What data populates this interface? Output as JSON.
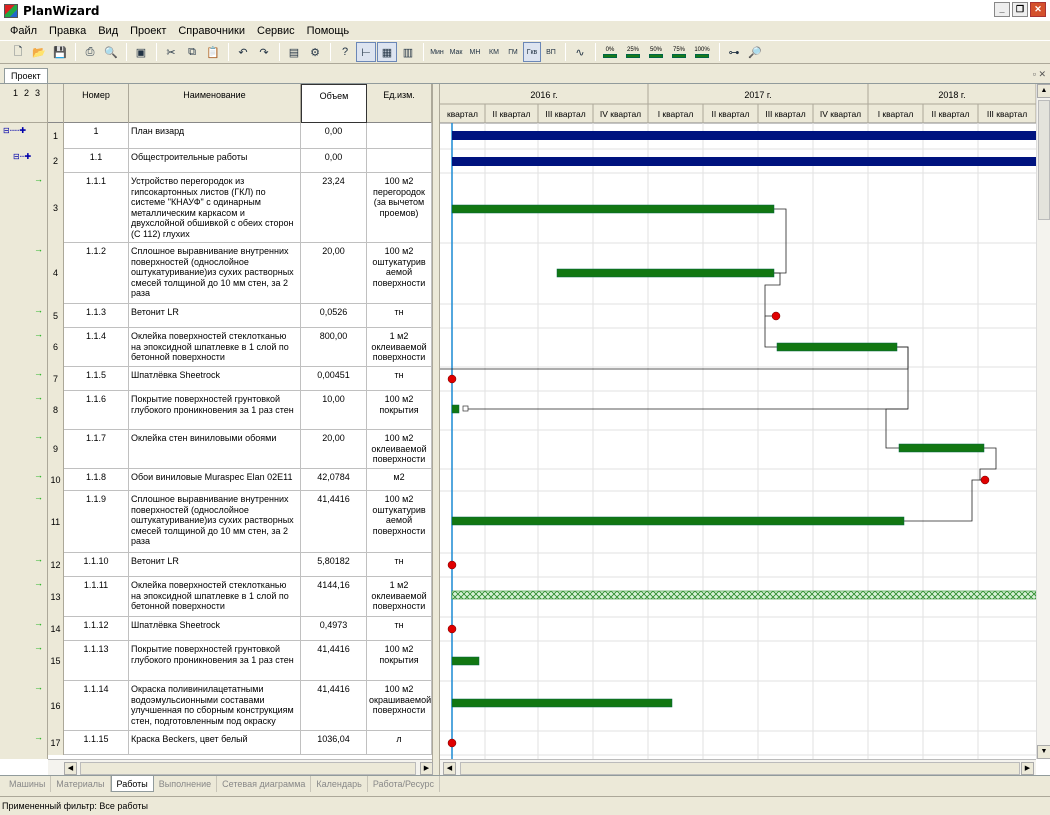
{
  "window": {
    "title": "PlanWizard"
  },
  "menu": [
    "Файл",
    "Правка",
    "Вид",
    "Проект",
    "Справочники",
    "Сервис",
    "Помощь"
  ],
  "toolbar": {
    "scale_buttons": [
      "Мин",
      "Мак",
      "МН",
      "КМ",
      "ГМ",
      "Гкв",
      "ВП"
    ],
    "pct_buttons": [
      "0%",
      "25%",
      "50%",
      "75%",
      "100%"
    ]
  },
  "project_tab": "Проект",
  "outline_levels": [
    "1",
    "2",
    "3"
  ],
  "columns": {
    "number": "Номер",
    "name": "Наименование",
    "volume": "Объем",
    "unit": "Ед.изм."
  },
  "timeline": {
    "years": [
      {
        "label": "2016 г."
      },
      {
        "label": "2017 г."
      },
      {
        "label": "2018 г."
      }
    ],
    "quarters": [
      "квартал",
      "II квартал",
      "III квартал",
      "IV квартал",
      "I квартал",
      "II квартал",
      "III квартал",
      "IV квартал",
      "I квартал",
      "II квартал",
      "III квартал"
    ]
  },
  "rows": [
    {
      "id": "1",
      "no": "1",
      "name": "План визард",
      "vol": "0,00",
      "unit": ""
    },
    {
      "id": "2",
      "no": "1.1",
      "name": "Общестроительные работы",
      "vol": "0,00",
      "unit": ""
    },
    {
      "id": "3",
      "no": "1.1.1",
      "name": "Устройство перегородок из гипсокартонных листов (ГКЛ) по системе \"КНАУФ\" с одинарным металлическим каркасом и двухслойной обшивкой с обеих сторон (С 112) глухих",
      "vol": "23,24",
      "unit": "100 м2 перегородок (за вычетом проемов)"
    },
    {
      "id": "4",
      "no": "1.1.2",
      "name": "Сплошное выравнивание внутренних поверхностей (однослойное оштукатуривание)из сухих растворных смесей толщиной до 10 мм стен, за 2 раза",
      "vol": "20,00",
      "unit": "100 м2 оштукатурив аемой поверхности"
    },
    {
      "id": "5",
      "no": "1.1.3",
      "name": "Ветонит LR",
      "vol": "0,0526",
      "unit": "тн"
    },
    {
      "id": "6",
      "no": "1.1.4",
      "name": "Оклейка поверхностей стеклотканью на эпоксидной шпатлевке в 1 слой по бетонной поверхности",
      "vol": "800,00",
      "unit": "1 м2 оклеиваемой поверхности"
    },
    {
      "id": "7",
      "no": "1.1.5",
      "name": "Шпатлёвка Sheetrock",
      "vol": "0,00451",
      "unit": "тн"
    },
    {
      "id": "8",
      "no": "1.1.6",
      "name": "Покрытие поверхностей грунтовкой глубокого проникновения за 1 раз стен",
      "vol": "10,00",
      "unit": "100 м2 покрытия"
    },
    {
      "id": "9",
      "no": "1.1.7",
      "name": "Оклейка стен виниловыми обоями",
      "vol": "20,00",
      "unit": "100 м2 оклеиваемой поверхности"
    },
    {
      "id": "10",
      "no": "1.1.8",
      "name": "Обои виниловые Muraspec Elan 02E11",
      "vol": "42,0784",
      "unit": "м2"
    },
    {
      "id": "11",
      "no": "1.1.9",
      "name": "Сплошное выравнивание внутренних поверхностей (однослойное оштукатуривание)из сухих растворных смесей толщиной до 10 мм стен, за 2 раза",
      "vol": "41,4416",
      "unit": "100 м2 оштукатурив аемой поверхности"
    },
    {
      "id": "12",
      "no": "1.1.10",
      "name": "Ветонит LR",
      "vol": "5,80182",
      "unit": "тн"
    },
    {
      "id": "13",
      "no": "1.1.11",
      "name": "Оклейка поверхностей стеклотканью на эпоксидной шпатлевке в 1 слой по бетонной поверхности",
      "vol": "4144,16",
      "unit": "1 м2 оклеиваемой поверхности"
    },
    {
      "id": "14",
      "no": "1.1.12",
      "name": "Шпатлёвка Sheetrock",
      "vol": "0,4973",
      "unit": "тн"
    },
    {
      "id": "15",
      "no": "1.1.13",
      "name": "Покрытие поверхностей грунтовкой глубокого проникновения за 1 раз стен",
      "vol": "41,4416",
      "unit": "100 м2 покрытия"
    },
    {
      "id": "16",
      "no": "1.1.14",
      "name": "Окраска поливинилацетатными водоэмульсионными составами улучшенная по сборным конструкциям стен, подготовленным под окраску",
      "vol": "41,4416",
      "unit": "100 м2 окрашиваемой поверхности"
    },
    {
      "id": "17",
      "no": "1.1.15",
      "name": "Краска Beckers, цвет белый",
      "vol": "1036,04",
      "unit": "л"
    }
  ],
  "bottom_tabs": [
    "Машины",
    "Материалы",
    "Работы",
    "Выполнение",
    "Сетевая диаграмма",
    "Календарь",
    "Работа/Ресурс"
  ],
  "active_bottom_tab": "Работы",
  "status": "Примененный фильтр: Все работы",
  "colors": {
    "summary_bar": "#00137f",
    "task_bar": "#127712",
    "milestone": "#e00000",
    "today_line": "#1a8ad4"
  }
}
